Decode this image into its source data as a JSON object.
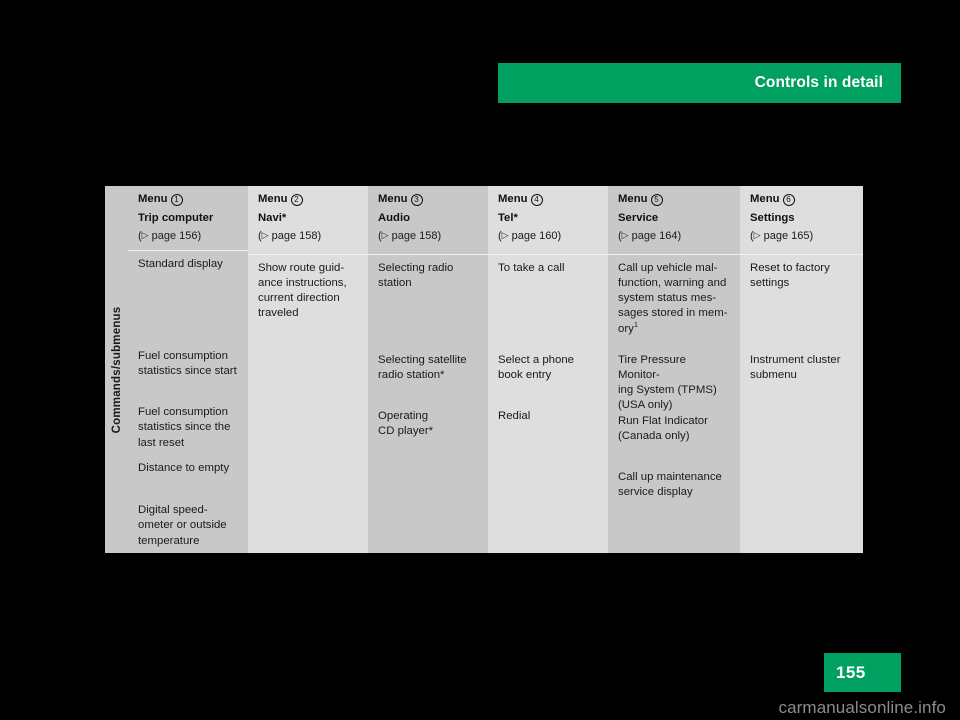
{
  "header": {
    "chapter_title": "Controls in detail",
    "banner_color": "#00a060"
  },
  "table": {
    "row_label": "Commands/submenus",
    "page_ref_prefix": "(",
    "page_ref_suffix": ")",
    "triangle_glyph": "▷",
    "columns": [
      {
        "menu_label": "Menu",
        "menu_number": "1",
        "title": "Trip computer",
        "page_ref": "page 156",
        "entries": [
          "Standard display",
          "Fuel consumption\nstatistics since start",
          "Fuel consumption\nstatistics since the\nlast reset",
          "Distance to empty",
          "Digital speed-\nometer or outside\ntemperature"
        ]
      },
      {
        "menu_label": "Menu",
        "menu_number": "2",
        "title": "Navi*",
        "page_ref": "page 158",
        "entries": [
          "Show route guid-\nance instructions,\ncurrent direction\ntraveled"
        ]
      },
      {
        "menu_label": "Menu",
        "menu_number": "3",
        "title": "Audio",
        "page_ref": "page 158",
        "entries": [
          "Selecting radio\nstation",
          "Selecting satellite\nradio station*",
          "Operating\nCD player*"
        ]
      },
      {
        "menu_label": "Menu",
        "menu_number": "4",
        "title": "Tel*",
        "page_ref": "page 160",
        "entries": [
          "To take a call",
          "Select a phone\nbook entry",
          "Redial"
        ]
      },
      {
        "menu_label": "Menu",
        "menu_number": "5",
        "title": "Service",
        "page_ref": "page 164",
        "entries": [
          "Call up vehicle mal-\nfunction, warning and\nsystem status mes-\nsages stored in mem-\nory",
          "Tire Pressure Monitor-\ning System (TPMS)\n(USA only)",
          "Run Flat Indicator\n(Canada only)",
          "Call up maintenance\nservice display"
        ],
        "footnote_marker": "1"
      },
      {
        "menu_label": "Menu",
        "menu_number": "6",
        "title": "Settings",
        "page_ref": "page 165",
        "entries": [
          "Reset to factory\nsettings",
          "Instrument cluster\nsubmenu"
        ]
      }
    ]
  },
  "footer": {
    "page_number": "155",
    "watermark": "carmanualsonline.info"
  }
}
